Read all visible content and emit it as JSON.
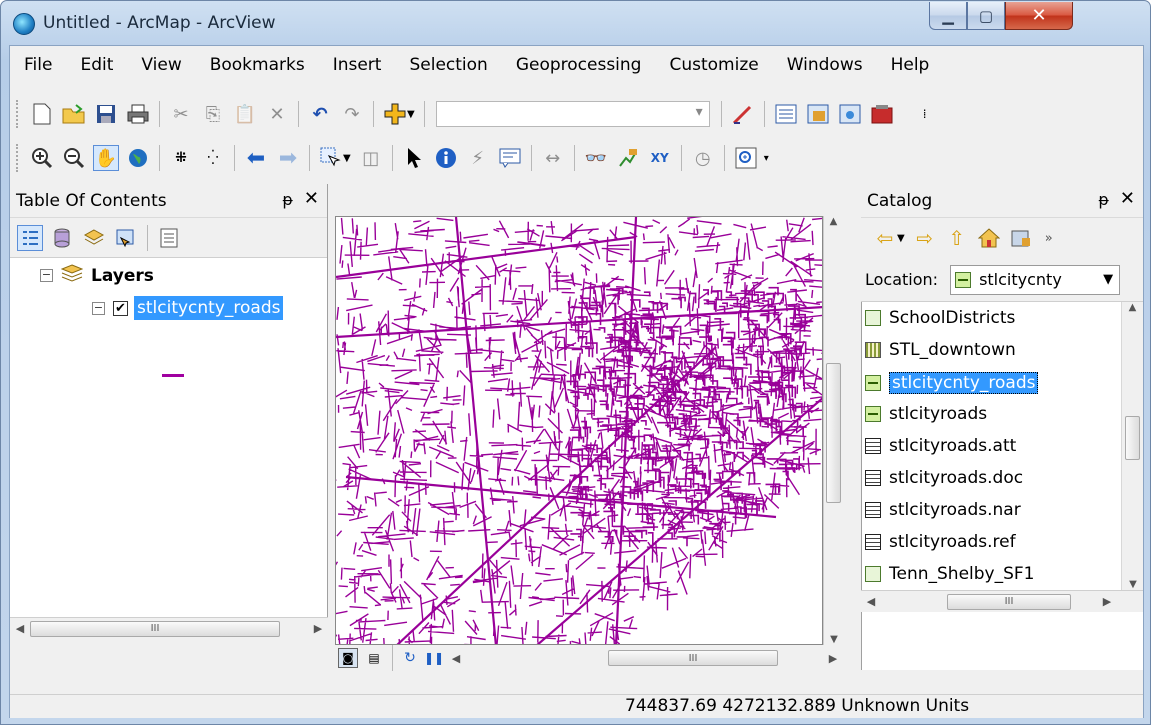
{
  "window": {
    "title": "Untitled - ArcMap - ArcView"
  },
  "menu": [
    "File",
    "Edit",
    "View",
    "Bookmarks",
    "Insert",
    "Selection",
    "Geoprocessing",
    "Customize",
    "Windows",
    "Help"
  ],
  "toc": {
    "title": "Table Of Contents",
    "pin": "ᵽ",
    "close": "✕",
    "layers_label": "Layers",
    "layer_name": "stlcitycnty_roads",
    "expander_minus": "⊟",
    "check": "✔",
    "scroll_marks": "III"
  },
  "catalog": {
    "title": "Catalog",
    "location_label": "Location:",
    "location_value": "stlcitycnty",
    "more": "»",
    "items": [
      {
        "name": "SchoolDistricts",
        "icon": "polygon-icon"
      },
      {
        "name": "STL_downtown",
        "icon": "raster-icon"
      },
      {
        "name": "stlcitycnty_roads",
        "icon": "line-feature-icon",
        "selected": true
      },
      {
        "name": "stlcityroads",
        "icon": "line-feature-icon"
      },
      {
        "name": "stlcityroads.att",
        "icon": "table-icon"
      },
      {
        "name": "stlcityroads.doc",
        "icon": "table-icon"
      },
      {
        "name": "stlcityroads.nar",
        "icon": "table-icon"
      },
      {
        "name": "stlcityroads.ref",
        "icon": "table-icon"
      },
      {
        "name": "Tenn_Shelby_SF1",
        "icon": "polygon-icon"
      }
    ]
  },
  "status": {
    "coords": "744837.69  4272132.889 Unknown Units"
  },
  "colors": {
    "road": "#990099",
    "selection": "#3399ff"
  }
}
